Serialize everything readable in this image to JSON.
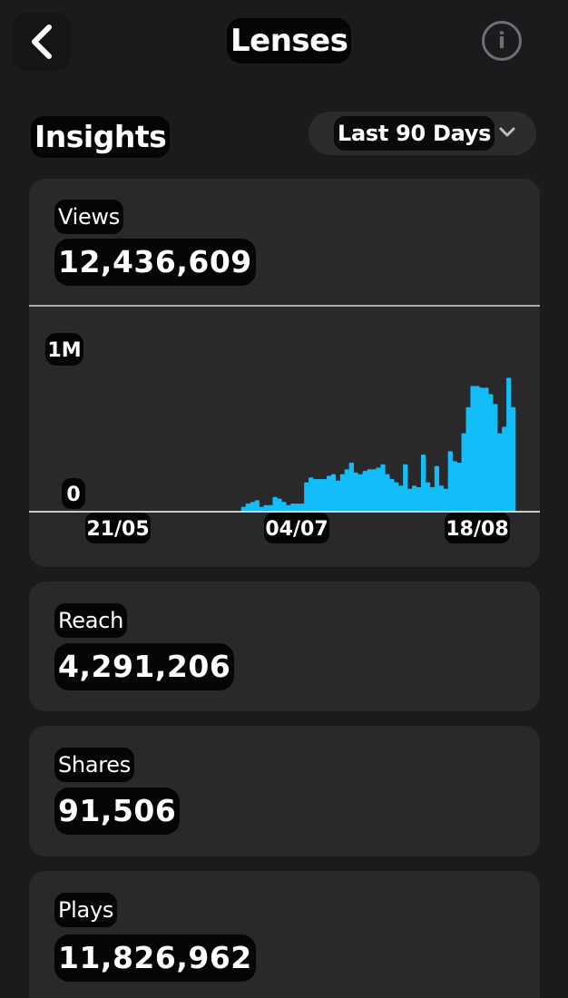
{
  "header": {
    "title": "Lenses",
    "back_icon": "chevron-left-icon",
    "info_icon": "info-icon",
    "info_glyph": "i"
  },
  "insights": {
    "heading": "Insights",
    "range_label": "Last 90 Days",
    "range_icon": "chevron-down-icon"
  },
  "cards": {
    "views": {
      "label": "Views",
      "value": "12,436,609"
    },
    "reach": {
      "label": "Reach",
      "value": "4,291,206"
    },
    "shares": {
      "label": "Shares",
      "value": "91,506"
    },
    "plays": {
      "label": "Plays",
      "value": "11,826,962"
    }
  },
  "chart_data": {
    "type": "bar",
    "color": "#13bef8",
    "y_tick_labels": [
      "1M",
      "0"
    ],
    "x_tick_labels": [
      "21/05",
      "04/07",
      "18/08"
    ],
    "ylim": [
      0,
      1000000
    ],
    "values": [
      0,
      0,
      0,
      0,
      0,
      0,
      0,
      0,
      0,
      0,
      0,
      0,
      0,
      0,
      0,
      0,
      0,
      0,
      0,
      0,
      0,
      0,
      0,
      0,
      0,
      0,
      0,
      30000,
      50000,
      60000,
      70000,
      30000,
      40000,
      40000,
      90000,
      80000,
      60000,
      40000,
      50000,
      50000,
      50000,
      180000,
      210000,
      200000,
      200000,
      200000,
      220000,
      230000,
      190000,
      230000,
      260000,
      300000,
      240000,
      230000,
      250000,
      260000,
      260000,
      270000,
      290000,
      230000,
      200000,
      180000,
      160000,
      290000,
      140000,
      160000,
      150000,
      350000,
      180000,
      150000,
      280000,
      160000,
      140000,
      370000,
      310000,
      300000,
      480000,
      640000,
      770000,
      770000,
      760000,
      760000,
      720000,
      660000,
      480000,
      520000,
      820000,
      640000
    ]
  }
}
